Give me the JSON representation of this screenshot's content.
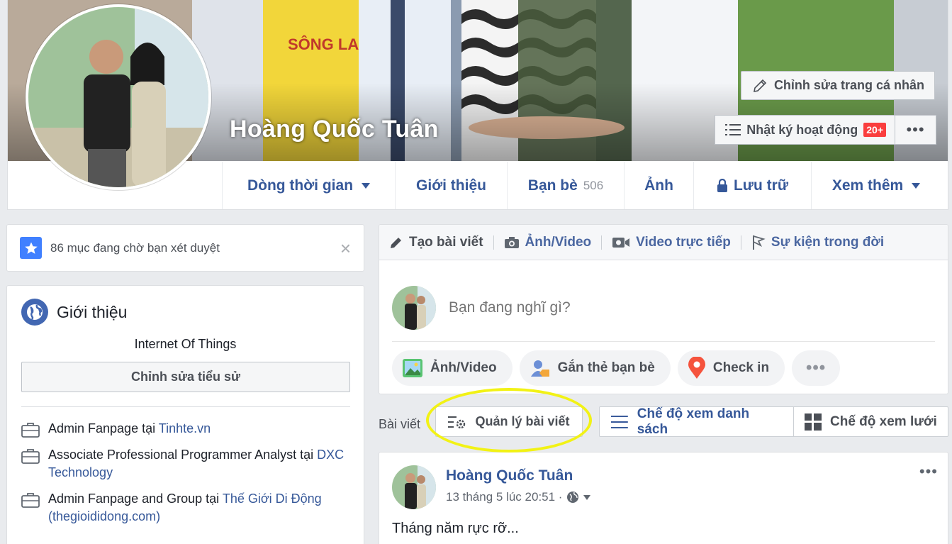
{
  "profile": {
    "name": "Hoàng Quốc Tuân",
    "edit_profile_label": "Chỉnh sửa trang cá nhân",
    "activity_log_label": "Nhật ký hoạt động",
    "activity_badge": "20+",
    "more_label": "•••"
  },
  "nav": {
    "tabs": [
      {
        "label": "Dòng thời gian",
        "caret": true
      },
      {
        "label": "Giới thiệu"
      },
      {
        "label": "Bạn bè",
        "count": "506"
      },
      {
        "label": "Ảnh"
      },
      {
        "label": "Lưu trữ",
        "icon": "lock-icon"
      },
      {
        "label": "Xem thêm",
        "caret": true
      }
    ]
  },
  "pending": {
    "text": "86 mục đang chờ bạn xét duyệt",
    "close": "×"
  },
  "intro": {
    "title": "Giới thiệu",
    "bio": "Internet Of Things",
    "edit_bio_label": "Chỉnh sửa tiểu sử",
    "work": [
      {
        "prefix": "Admin Fanpage tại ",
        "link": "Tinhte.vn"
      },
      {
        "prefix": "Associate Professional Programmer Analyst tại ",
        "link": "DXC Technology"
      },
      {
        "prefix": "Admin Fanpage and Group tại ",
        "link": "Thế Giới Di Động (thegioididong.com)"
      }
    ]
  },
  "composer": {
    "tabs": [
      "Tạo bài viết",
      "Ảnh/Video",
      "Video trực tiếp",
      "Sự kiện trong đời"
    ],
    "placeholder": "Bạn đang nghĩ gì?",
    "actions": [
      "Ảnh/Video",
      "Gắn thẻ bạn bè",
      "Check in"
    ],
    "more": "•••"
  },
  "posts_bar": {
    "label": "Bài viết",
    "manage_label": "Quản lý bài viết",
    "list_view_label": "Chế độ xem danh sách",
    "grid_view_label": "Chế độ xem lưới"
  },
  "post": {
    "author": "Hoàng Quốc Tuân",
    "time": "13 tháng 5 lúc 20:51 ·",
    "text": "Tháng năm rực rỡ...",
    "more": "•••"
  },
  "colors": {
    "link_blue": "#365899",
    "badge_red": "#fa3e3e",
    "highlight_yellow": "#f2f215",
    "page_bg": "#e9ebee"
  }
}
